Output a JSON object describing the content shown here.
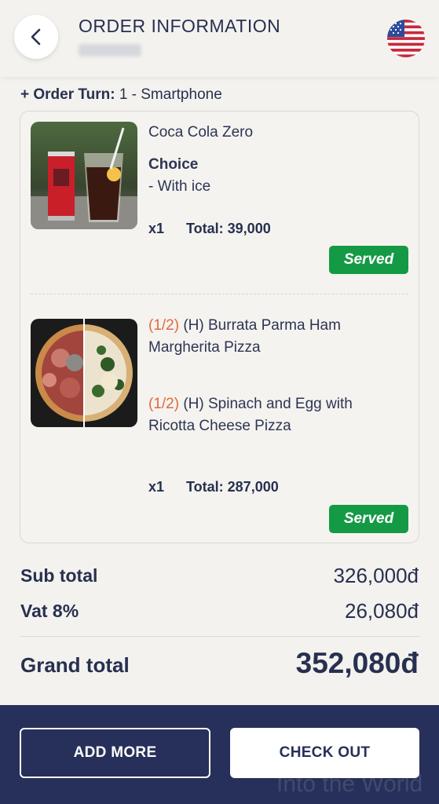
{
  "header": {
    "title": "ORDER INFORMATION"
  },
  "order_turn": {
    "label": "+ Order Turn:",
    "value": "1 - Smartphone"
  },
  "items": [
    {
      "name": "Coca Cola Zero",
      "choice_label": "Choice",
      "choice_value": "- With ice",
      "qty": "x1",
      "total": "Total: 39,000",
      "status": "Served"
    },
    {
      "half1_tag": "(1/2)",
      "half1_name": "(H) Burrata Parma Ham Margherita Pizza",
      "half2_tag": "(1/2)",
      "half2_name": "(H) Spinach and Egg with Ricotta Cheese Pizza",
      "qty": "x1",
      "total": "Total: 287,000",
      "status": "Served"
    }
  ],
  "summary": {
    "subtotal_label": "Sub total",
    "subtotal_value": "326,000đ",
    "vat_label": "Vat 8%",
    "vat_value": "26,080đ",
    "grand_label": "Grand total",
    "grand_value": "352,080đ"
  },
  "footer": {
    "add_more_label": "ADD MORE",
    "checkout_label": "CHECK OUT",
    "watermark": "Into the World"
  },
  "colors": {
    "navy": "#27305a",
    "served_green": "#149a45",
    "half_orange": "#e0693a",
    "background": "#f3f2ef"
  },
  "icons": {
    "back": "chevron-left-icon",
    "language": "us-flag-icon"
  }
}
